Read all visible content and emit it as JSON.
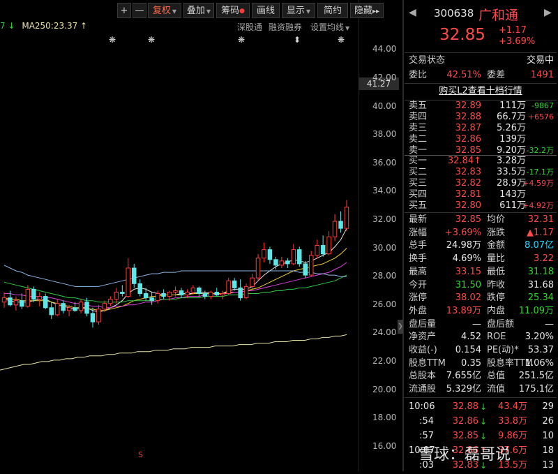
{
  "toolbar": {
    "plus": "+",
    "minus": "—",
    "fuquan": "复权",
    "diejia": "叠加",
    "chouma": "筹码",
    "huaxian": "画线",
    "xianshi": "显示",
    "jianyue": "简约",
    "yincang": "隐藏",
    "more": "▸▸"
  },
  "ma_row": {
    "prefix": "7 ↓",
    "ma250": "MA250:23.37 ↑"
  },
  "chart_links": {
    "shengutong": "深股通",
    "rongzirongquan": "融资融券",
    "shezhi": "设置均线"
  },
  "price_tag": "41.27",
  "event_markers": [
    "❋",
    "❋",
    "❋",
    "⬍",
    "❋"
  ],
  "s_marker": "S",
  "chart_data": {
    "type": "candlestick",
    "yticks": [
      "44.00",
      "42.00",
      "40.00",
      "38.00",
      "36.00",
      "34.00",
      "32.00",
      "30.00",
      "28.00",
      "26.00",
      "24.00",
      "22.00",
      "20.00",
      "18.00",
      "16.00"
    ],
    "ylim": [
      15.0,
      45.5
    ],
    "candles": [
      {
        "o": 26.2,
        "h": 26.9,
        "l": 25.8,
        "c": 26.5
      },
      {
        "o": 26.5,
        "h": 27.0,
        "l": 25.9,
        "c": 26.0
      },
      {
        "o": 26.0,
        "h": 26.6,
        "l": 25.6,
        "c": 26.3
      },
      {
        "o": 26.3,
        "h": 26.8,
        "l": 25.7,
        "c": 25.9
      },
      {
        "o": 25.9,
        "h": 27.4,
        "l": 25.8,
        "c": 27.1
      },
      {
        "o": 27.1,
        "h": 27.3,
        "l": 26.2,
        "c": 26.4
      },
      {
        "o": 26.4,
        "h": 26.9,
        "l": 25.9,
        "c": 26.6
      },
      {
        "o": 26.6,
        "h": 26.8,
        "l": 25.7,
        "c": 25.8
      },
      {
        "o": 25.8,
        "h": 26.2,
        "l": 25.0,
        "c": 25.3
      },
      {
        "o": 25.3,
        "h": 26.4,
        "l": 25.2,
        "c": 26.1
      },
      {
        "o": 26.1,
        "h": 26.3,
        "l": 25.4,
        "c": 25.6
      },
      {
        "o": 25.6,
        "h": 26.0,
        "l": 25.2,
        "c": 25.8
      },
      {
        "o": 25.8,
        "h": 26.2,
        "l": 25.5,
        "c": 25.6
      },
      {
        "o": 25.6,
        "h": 26.4,
        "l": 25.4,
        "c": 26.2
      },
      {
        "o": 26.2,
        "h": 26.5,
        "l": 25.2,
        "c": 25.4
      },
      {
        "o": 25.4,
        "h": 25.8,
        "l": 24.4,
        "c": 24.8
      },
      {
        "o": 24.8,
        "h": 26.0,
        "l": 24.6,
        "c": 25.7
      },
      {
        "o": 25.7,
        "h": 26.3,
        "l": 25.5,
        "c": 26.1
      },
      {
        "o": 26.1,
        "h": 26.6,
        "l": 25.9,
        "c": 26.4
      },
      {
        "o": 26.4,
        "h": 27.2,
        "l": 26.1,
        "c": 26.9
      },
      {
        "o": 26.9,
        "h": 27.4,
        "l": 26.6,
        "c": 26.8
      },
      {
        "o": 26.6,
        "h": 29.3,
        "l": 26.5,
        "c": 28.6
      },
      {
        "o": 28.6,
        "h": 28.9,
        "l": 27.2,
        "c": 27.5
      },
      {
        "o": 27.5,
        "h": 27.8,
        "l": 26.6,
        "c": 26.8
      },
      {
        "o": 26.8,
        "h": 27.2,
        "l": 26.3,
        "c": 26.5
      },
      {
        "o": 26.5,
        "h": 26.9,
        "l": 26.0,
        "c": 26.3
      },
      {
        "o": 26.3,
        "h": 27.0,
        "l": 26.1,
        "c": 26.8
      },
      {
        "o": 26.8,
        "h": 27.1,
        "l": 26.4,
        "c": 26.6
      },
      {
        "o": 26.6,
        "h": 27.0,
        "l": 26.3,
        "c": 26.9
      },
      {
        "o": 26.9,
        "h": 27.3,
        "l": 26.6,
        "c": 27.0
      },
      {
        "o": 27.0,
        "h": 27.2,
        "l": 26.5,
        "c": 26.7
      },
      {
        "o": 26.7,
        "h": 27.1,
        "l": 26.5,
        "c": 26.9
      },
      {
        "o": 26.9,
        "h": 27.4,
        "l": 26.7,
        "c": 27.2
      },
      {
        "o": 27.2,
        "h": 27.3,
        "l": 26.6,
        "c": 26.8
      },
      {
        "o": 26.8,
        "h": 27.0,
        "l": 26.4,
        "c": 26.6
      },
      {
        "o": 26.6,
        "h": 27.0,
        "l": 26.4,
        "c": 26.9
      },
      {
        "o": 26.9,
        "h": 27.2,
        "l": 26.6,
        "c": 26.7
      },
      {
        "o": 26.7,
        "h": 27.0,
        "l": 26.4,
        "c": 26.8
      },
      {
        "o": 26.8,
        "h": 27.9,
        "l": 26.7,
        "c": 27.7
      },
      {
        "o": 27.7,
        "h": 27.9,
        "l": 27.0,
        "c": 27.2
      },
      {
        "o": 27.2,
        "h": 27.8,
        "l": 26.3,
        "c": 26.5
      },
      {
        "o": 26.5,
        "h": 27.5,
        "l": 26.4,
        "c": 27.3
      },
      {
        "o": 27.3,
        "h": 28.2,
        "l": 27.1,
        "c": 27.9
      },
      {
        "o": 27.9,
        "h": 29.6,
        "l": 27.7,
        "c": 29.3
      },
      {
        "o": 29.3,
        "h": 30.4,
        "l": 29.0,
        "c": 29.9
      },
      {
        "o": 29.9,
        "h": 30.1,
        "l": 28.9,
        "c": 29.2
      },
      {
        "o": 29.2,
        "h": 29.4,
        "l": 28.5,
        "c": 28.8
      },
      {
        "o": 28.8,
        "h": 29.4,
        "l": 28.6,
        "c": 29.1
      },
      {
        "o": 29.1,
        "h": 29.3,
        "l": 28.6,
        "c": 28.9
      },
      {
        "o": 28.9,
        "h": 30.3,
        "l": 28.8,
        "c": 29.9
      },
      {
        "o": 29.9,
        "h": 30.1,
        "l": 28.7,
        "c": 28.9
      },
      {
        "o": 28.9,
        "h": 29.1,
        "l": 27.9,
        "c": 28.1
      },
      {
        "o": 28.1,
        "h": 29.8,
        "l": 28.0,
        "c": 29.5
      },
      {
        "o": 29.5,
        "h": 30.6,
        "l": 29.3,
        "c": 30.2
      },
      {
        "o": 30.2,
        "h": 30.9,
        "l": 29.4,
        "c": 29.6
      },
      {
        "o": 29.6,
        "h": 31.2,
        "l": 29.5,
        "c": 30.8
      },
      {
        "o": 30.8,
        "h": 32.4,
        "l": 30.5,
        "c": 31.9
      },
      {
        "o": 31.9,
        "h": 32.6,
        "l": 31.1,
        "c": 31.4
      },
      {
        "o": 31.4,
        "h": 33.4,
        "l": 31.2,
        "c": 32.9
      }
    ],
    "candle_colors": {
      "up": "#ff3c3c",
      "down": "#5fe6e6"
    },
    "ma_lines": [
      {
        "color": "#e8e8e8",
        "values": [
          26.4,
          26.3,
          26.2,
          26.2,
          26.2,
          26.3,
          26.4,
          26.4,
          26.2,
          26.0,
          25.9,
          25.8,
          25.7,
          25.8,
          25.8,
          25.6,
          25.5,
          25.6,
          25.8,
          26.0,
          26.3,
          26.8,
          27.1,
          27.2,
          27.1,
          26.9,
          26.8,
          26.7,
          26.7,
          26.7,
          26.8,
          26.8,
          26.8,
          26.9,
          26.9,
          26.8,
          26.8,
          26.8,
          27.0,
          27.1,
          27.1,
          27.1,
          27.3,
          27.7,
          28.1,
          28.4,
          28.7,
          28.9,
          29.0,
          29.2,
          29.1,
          29.0,
          29.1,
          29.3,
          29.5,
          29.7,
          30.1,
          30.6,
          31.4
        ]
      },
      {
        "color": "#f2d12a",
        "values": [
          26.5,
          26.4,
          26.4,
          26.3,
          26.3,
          26.3,
          26.3,
          26.3,
          26.2,
          26.1,
          26.0,
          25.9,
          25.8,
          25.8,
          25.7,
          25.7,
          25.6,
          25.6,
          25.7,
          25.8,
          25.9,
          26.1,
          26.3,
          26.4,
          26.5,
          26.6,
          26.6,
          26.7,
          26.7,
          26.7,
          26.7,
          26.7,
          26.8,
          26.8,
          26.8,
          26.8,
          26.8,
          26.8,
          26.9,
          26.9,
          26.9,
          27.0,
          27.1,
          27.2,
          27.4,
          27.6,
          27.8,
          28.0,
          28.2,
          28.4,
          28.5,
          28.6,
          28.7,
          28.8,
          28.9,
          29.1,
          29.3,
          29.6,
          30.0
        ]
      },
      {
        "color": "#e040e0",
        "values": [
          26.8,
          26.8,
          26.7,
          26.7,
          26.6,
          26.6,
          26.6,
          26.5,
          26.5,
          26.4,
          26.3,
          26.2,
          26.1,
          26.1,
          26.0,
          25.9,
          25.9,
          25.8,
          25.8,
          25.9,
          25.9,
          26.0,
          26.0,
          26.1,
          26.2,
          26.2,
          26.3,
          26.4,
          26.4,
          26.5,
          26.5,
          26.6,
          26.6,
          26.6,
          26.7,
          26.7,
          26.7,
          26.8,
          26.8,
          26.9,
          26.9,
          27.0,
          27.0,
          27.1,
          27.2,
          27.3,
          27.4,
          27.5,
          27.6,
          27.7,
          27.8,
          27.9,
          28.0,
          28.1,
          28.2,
          28.3,
          28.5,
          28.7,
          29.0
        ]
      },
      {
        "color": "#2ecc40",
        "values": [
          27.6,
          27.5,
          27.4,
          27.3,
          27.2,
          27.1,
          27.0,
          26.9,
          26.8,
          26.7,
          26.6,
          26.5,
          26.5,
          26.4,
          26.3,
          26.3,
          26.2,
          26.2,
          26.2,
          26.2,
          26.2,
          26.3,
          26.3,
          26.3,
          26.3,
          26.3,
          26.4,
          26.4,
          26.4,
          26.4,
          26.5,
          26.5,
          26.5,
          26.5,
          26.6,
          26.6,
          26.6,
          26.6,
          26.7,
          26.7,
          26.7,
          26.8,
          26.8,
          26.8,
          26.9,
          26.9,
          27.0,
          27.0,
          27.1,
          27.1,
          27.2,
          27.2,
          27.3,
          27.4,
          27.5,
          27.6,
          27.7,
          27.9,
          28.1
        ]
      },
      {
        "color": "#8fb8e8",
        "values": [
          28.8,
          28.6,
          28.4,
          28.3,
          28.1,
          28.0,
          27.9,
          27.8,
          27.7,
          27.6,
          27.5,
          27.4,
          27.3,
          27.3,
          27.3,
          27.3,
          27.3,
          27.4,
          27.5,
          27.6,
          27.7,
          27.8,
          27.9,
          28.0,
          28.1,
          28.2,
          28.2,
          28.3,
          28.3,
          28.3,
          28.4,
          28.4,
          28.4,
          28.4,
          28.4,
          28.4,
          28.4,
          28.4,
          28.4,
          28.4,
          28.4,
          28.4,
          28.4,
          28.4,
          28.4,
          28.4,
          28.4,
          28.4,
          28.4,
          28.4,
          28.3,
          28.3,
          28.3,
          28.2,
          28.2,
          28.1,
          28.1,
          28.0,
          28.0
        ]
      },
      {
        "color": "#e8e6a8",
        "values": [
          21.4,
          21.5,
          21.6,
          21.7,
          21.8,
          21.8,
          21.9,
          22.0,
          22.0,
          22.1,
          22.1,
          22.2,
          22.2,
          22.3,
          22.3,
          22.4,
          22.4,
          22.4,
          22.5,
          22.5,
          22.6,
          22.6,
          22.6,
          22.7,
          22.7,
          22.7,
          22.8,
          22.8,
          22.8,
          22.9,
          22.9,
          22.9,
          23.0,
          23.0,
          23.0,
          23.0,
          23.1,
          23.1,
          23.1,
          23.1,
          23.2,
          23.2,
          23.2,
          23.3,
          23.3,
          23.3,
          23.4,
          23.4,
          23.4,
          23.5,
          23.5,
          23.5,
          23.6,
          23.6,
          23.7,
          23.7,
          23.8,
          23.8,
          23.9
        ]
      }
    ]
  },
  "panel": {
    "code": "300638",
    "name": "广和通",
    "price": "32.85",
    "change": "+1.17",
    "change_pct": "+3.69%",
    "status_label": "交易状态",
    "status_value": "交易中",
    "weibi_label": "委比",
    "weibi_value": "42.51%",
    "weicha_label": "委差",
    "weicha_value": "1491",
    "l2_link": "购买L2查看十档行情",
    "asks": [
      {
        "label": "卖五",
        "price": "32.89",
        "vol": "111万",
        "delta": "-9867",
        "dc": "g"
      },
      {
        "label": "卖四",
        "price": "32.88",
        "vol": "66.7万",
        "delta": "+6576",
        "dc": "r"
      },
      {
        "label": "卖三",
        "price": "32.87",
        "vol": "5.26万",
        "delta": "",
        "dc": "w"
      },
      {
        "label": "卖二",
        "price": "32.86",
        "vol": "139万",
        "delta": "",
        "dc": "w"
      },
      {
        "label": "卖一",
        "price": "32.85",
        "vol": "9.20万",
        "delta": "-32.2万",
        "dc": "g"
      }
    ],
    "bids": [
      {
        "label": "买一",
        "price": "32.84↑",
        "vol": "3.28万",
        "delta": "",
        "dc": "w"
      },
      {
        "label": "买二",
        "price": "32.83",
        "vol": "33.5万",
        "delta": "-17.1万",
        "dc": "g"
      },
      {
        "label": "买三",
        "price": "32.82",
        "vol": "28.9万",
        "delta": "+4.59万",
        "dc": "r"
      },
      {
        "label": "买四",
        "price": "32.81",
        "vol": "143万",
        "delta": "",
        "dc": "w"
      },
      {
        "label": "买五",
        "price": "32.80",
        "vol": "611万",
        "delta": "+4.92万",
        "dc": "r"
      }
    ],
    "stats": [
      {
        "l1": "最新",
        "v1": "32.85",
        "c1": "r",
        "l2": "均价",
        "v2": "32.31",
        "c2": "r"
      },
      {
        "l1": "涨幅",
        "v1": "+3.69%",
        "c1": "r",
        "l2": "涨跌",
        "v2": "▲1.17",
        "c2": "r"
      },
      {
        "l1": "总手",
        "v1": "24.98万",
        "c1": "w",
        "l2": "金额",
        "v2": "8.07亿",
        "c2": "c"
      },
      {
        "l1": "换手",
        "v1": "4.69%",
        "c1": "w",
        "l2": "量比",
        "v2": "3.22",
        "c2": "r"
      },
      {
        "l1": "最高",
        "v1": "33.15",
        "c1": "r",
        "l2": "最低",
        "v2": "31.18",
        "c2": "g"
      },
      {
        "l1": "今开",
        "v1": "31.50",
        "c1": "g",
        "l2": "昨收",
        "v2": "31.68",
        "c2": "w"
      },
      {
        "l1": "涨停",
        "v1": "38.02",
        "c1": "r",
        "l2": "跌停",
        "v2": "25.34",
        "c2": "g"
      },
      {
        "l1": "外盘",
        "v1": "13.89万",
        "c1": "r",
        "l2": "内盘",
        "v2": "11.09万",
        "c2": "g"
      },
      {
        "l1": "盘后量",
        "v1": "—",
        "c1": "w",
        "l2": "盘后额",
        "v2": "—",
        "c2": "w"
      },
      {
        "l1": "净资产",
        "v1": "4.52",
        "c1": "w",
        "l2": "ROE",
        "v2": "3.20%",
        "c2": "w"
      },
      {
        "l1": "收益(-)",
        "v1": "0.154",
        "c1": "w",
        "l2": "PE(动)*",
        "v2": "53.37",
        "c2": "w"
      },
      {
        "l1": "股息TTM",
        "v1": "0.35",
        "c1": "w",
        "l2": "股息率TTM",
        "v2": "1.06%",
        "c2": "w"
      },
      {
        "l1": "总股本",
        "v1": "7.655亿",
        "c1": "w",
        "l2": "总值",
        "v2": "251.5亿",
        "c2": "w"
      },
      {
        "l1": "流通股",
        "v1": "5.329亿",
        "c1": "w",
        "l2": "流值",
        "v2": "175.1亿",
        "c2": "w"
      }
    ],
    "ticks": [
      {
        "time": "10:06",
        "price": "32.88",
        "arrow": "↓",
        "vol": "43.4万",
        "n": "29"
      },
      {
        "time": ":54",
        "price": "32.86",
        "arrow": "↓",
        "vol": "33.8万",
        "n": "26"
      },
      {
        "time": ":57",
        "price": "32.85",
        "arrow": "↓",
        "vol": "9.86万",
        "n": "10"
      },
      {
        "time": "10:07",
        "price": "32.86",
        "arrow": "↑",
        "vol": "37.6万",
        "n": "18"
      },
      {
        "time": ":03",
        "price": "32.83",
        "arrow": "↓",
        "vol": "13.5万",
        "n": "13"
      }
    ]
  },
  "watermark": "雪球：磊哥说"
}
